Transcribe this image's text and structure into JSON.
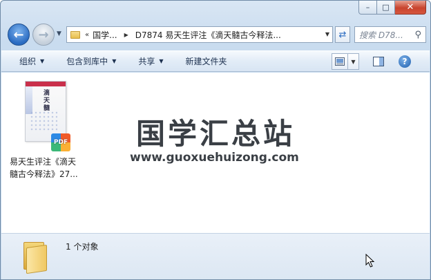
{
  "window": {
    "caption": {
      "minimize": "–",
      "maximize": "□",
      "close": "✕"
    }
  },
  "nav": {
    "back_icon": "back-arrow-icon",
    "forward_icon": "forward-arrow-icon",
    "breadcrumb": {
      "overflow": "«",
      "items": [
        "国学...",
        "D7874 易天生评注《滴天髓古今释法..."
      ]
    },
    "search": {
      "placeholder": "搜索 D78..."
    }
  },
  "toolbar": {
    "commands": [
      {
        "label": "组织",
        "has_menu": true
      },
      {
        "label": "包含到库中",
        "has_menu": true
      },
      {
        "label": "共享",
        "has_menu": true
      },
      {
        "label": "新建文件夹",
        "has_menu": false
      }
    ]
  },
  "content": {
    "files": [
      {
        "name_line1": "易天生评注《滴天",
        "name_line2": "髓古今释法》27...",
        "thumb_title": "滴天髓",
        "badge": "PDF"
      }
    ],
    "watermark": {
      "title": "国学汇总站",
      "url": "www.guoxuehuizong.com"
    }
  },
  "details": {
    "status": "1 个对象"
  },
  "colors": {
    "frame": "#c9dcef",
    "close_button": "#c8442e",
    "accent_blue": "#2a6bc1"
  }
}
